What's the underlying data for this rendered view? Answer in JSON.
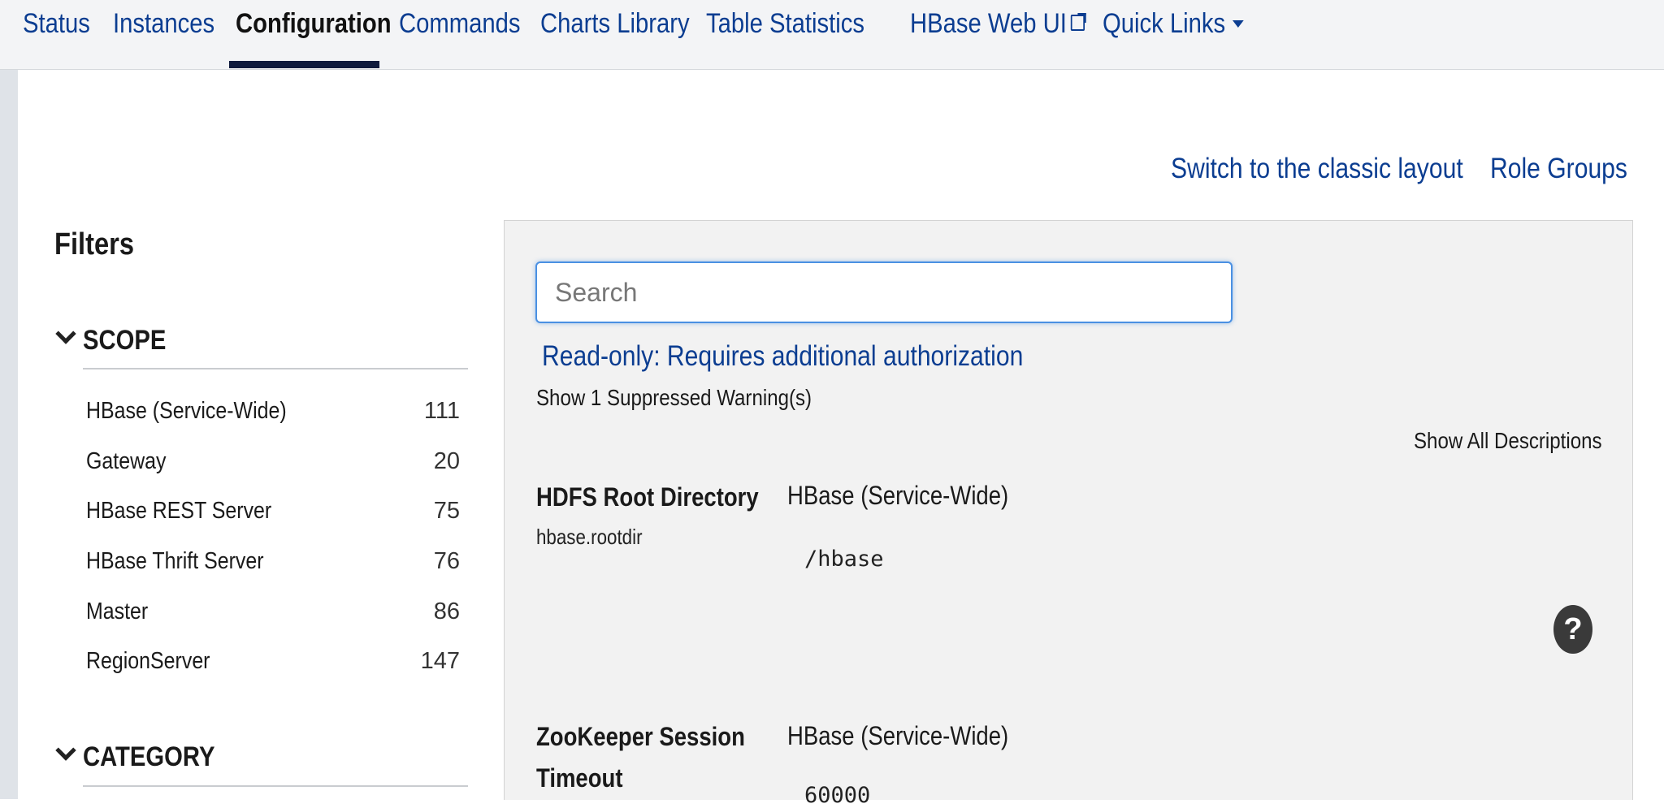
{
  "nav": {
    "tabs": [
      {
        "label": "Status"
      },
      {
        "label": "Instances"
      },
      {
        "label": "Configuration"
      },
      {
        "label": "Commands"
      },
      {
        "label": "Charts Library"
      },
      {
        "label": "Table Statistics"
      },
      {
        "label": "HBase Web UI"
      },
      {
        "label": "Quick Links"
      }
    ],
    "active_tab": "Configuration",
    "external_icon": "external-link-icon",
    "dropdown_icon": "caret-down-icon"
  },
  "header_links": {
    "classic_layout": "Switch to the classic layout",
    "role_groups": "Role Groups"
  },
  "filters": {
    "title": "Filters",
    "scope": {
      "heading": "SCOPE",
      "items": [
        {
          "label": "HBase (Service-Wide)",
          "count": "111"
        },
        {
          "label": "Gateway",
          "count": "20"
        },
        {
          "label": "HBase REST Server",
          "count": "75"
        },
        {
          "label": "HBase Thrift Server",
          "count": "76"
        },
        {
          "label": "Master",
          "count": "86"
        },
        {
          "label": "RegionServer",
          "count": "147"
        }
      ]
    },
    "category": {
      "heading": "CATEGORY"
    }
  },
  "main": {
    "search_placeholder": "Search",
    "readonly_notice": "Read-only: Requires additional authorization",
    "suppressed_link": "Show 1 Suppressed Warning(s)",
    "show_descriptions": "Show All Descriptions",
    "help_icon_glyph": "?",
    "properties": [
      {
        "name": "HDFS Root Directory",
        "key": "hbase.rootdir",
        "scope": "HBase (Service-Wide)",
        "value": "/hbase"
      },
      {
        "name_line1": "ZooKeeper Session",
        "name_line2": "Timeout",
        "scope": "HBase (Service-Wide)",
        "value": "60000"
      }
    ]
  },
  "colors": {
    "link": "#0b3d91",
    "active_underline": "#0f1a3d",
    "panel_bg": "#f2f2f2",
    "focus_ring": "#4a90e2"
  }
}
